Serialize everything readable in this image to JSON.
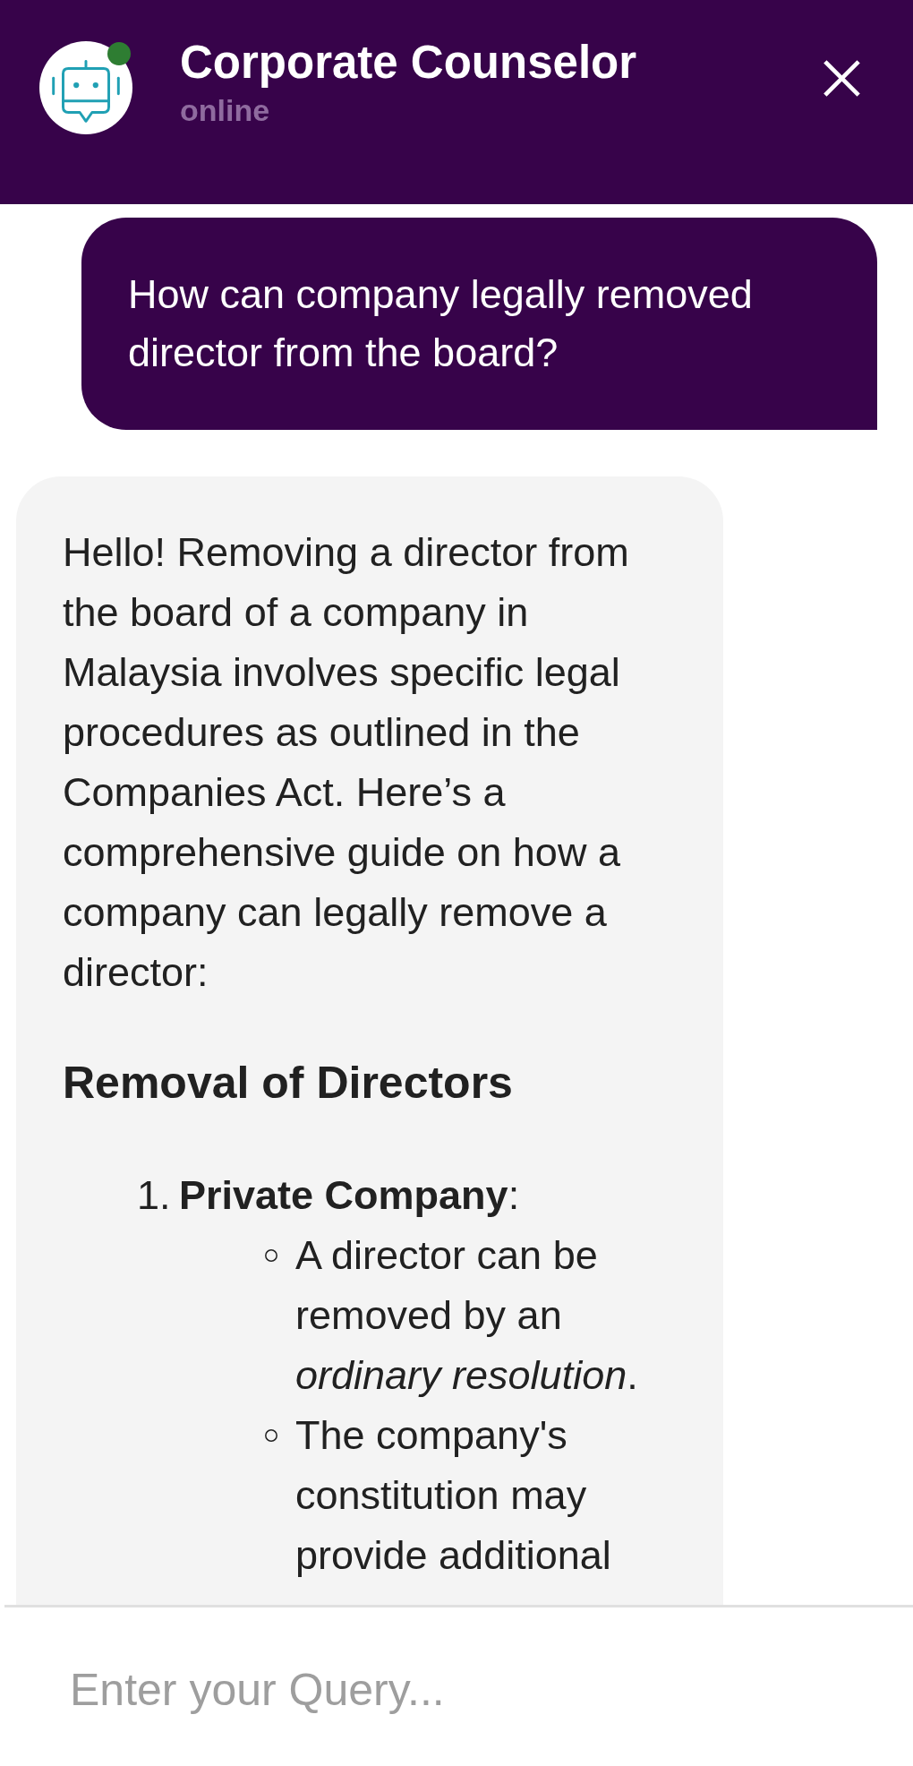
{
  "header": {
    "title": "Corporate Counselor",
    "status": "online",
    "online": true
  },
  "messages": [
    {
      "kind": "user",
      "text": "How can company legally removed director from the board?"
    },
    {
      "kind": "bot",
      "blocks": [
        {
          "kind": "paragraph",
          "text": "Hello! Removing a director from the board of a company in Malaysia involves specific legal procedures as outlined in the Companies Act. Here’s a comprehensive guide on how a company can legally remove a director:"
        },
        {
          "kind": "heading",
          "text": "Removal of Directors"
        },
        {
          "kind": "ordered_list",
          "items": [
            {
              "marker": "1.",
              "text": "**Private Company**:",
              "children": [
                {
                  "text": "A director can be removed by an *ordinary resolution*."
                },
                {
                  "text": "The company's constitution may provide additional"
                }
              ]
            }
          ]
        }
      ]
    }
  ],
  "composer": {
    "placeholder": "Enter your Query..."
  }
}
